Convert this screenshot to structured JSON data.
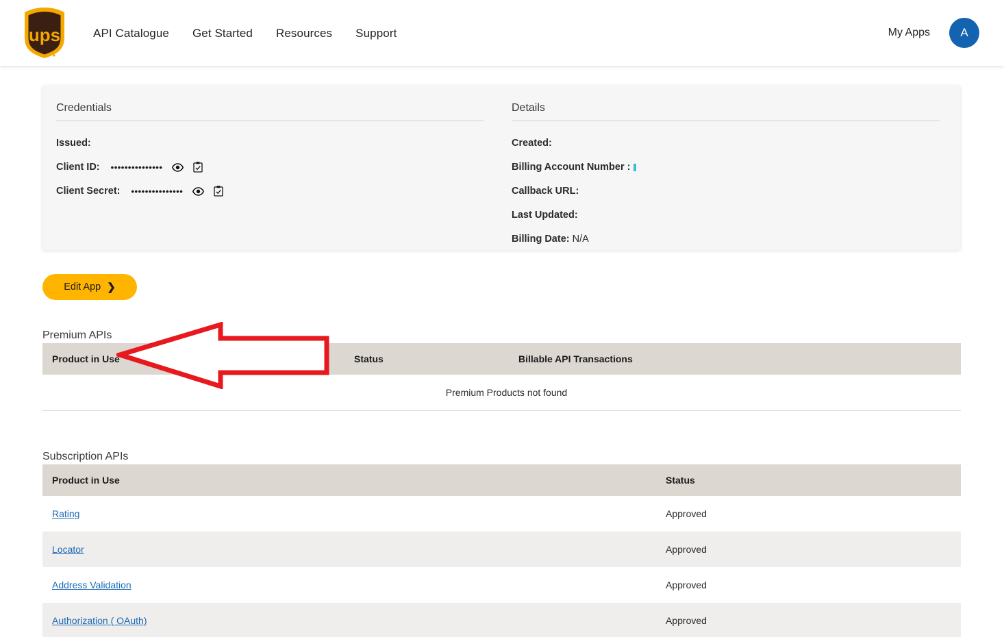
{
  "header": {
    "logo_alt": "UPS",
    "nav": [
      {
        "label": "API Catalogue"
      },
      {
        "label": "Get Started"
      },
      {
        "label": "Resources"
      },
      {
        "label": "Support"
      }
    ],
    "my_apps_label": "My Apps",
    "avatar_initial": "A"
  },
  "credentials": {
    "title": "Credentials",
    "issued_label": "Issued:",
    "issued_value": "",
    "client_id_label": "Client ID:",
    "client_id_value": "•••••••••••••••",
    "client_secret_label": "Client Secret:",
    "client_secret_value": "•••••••••••••••",
    "show_icon": "eye-icon",
    "copy_icon": "clipboard-check-icon"
  },
  "details": {
    "title": "Details",
    "created_label": "Created:",
    "created_value": "",
    "billing_account_label": "Billing Account Number :",
    "billing_account_value": "",
    "callback_url_label": "Callback URL:",
    "callback_url_value": "",
    "last_updated_label": "Last Updated:",
    "last_updated_value": "",
    "billing_date_label": "Billing Date:",
    "billing_date_value": "N/A"
  },
  "actions": {
    "edit_app_label": "Edit App",
    "edit_app_chevron": "›"
  },
  "annotation": {
    "type": "left-arrow",
    "color": "#e8191e",
    "points_to": "edit-app-button"
  },
  "premium_apis": {
    "heading": "Premium APIs",
    "columns": [
      "Product in Use",
      "Status",
      "Billable API Transactions"
    ],
    "empty_message": "Premium Products not found",
    "rows": []
  },
  "subscription_apis": {
    "heading": "Subscription APIs",
    "columns": [
      "Product in Use",
      "Status"
    ],
    "rows": [
      {
        "product": "Rating",
        "status": "Approved"
      },
      {
        "product": "Locator",
        "status": "Approved"
      },
      {
        "product": "Address Validation",
        "status": "Approved"
      },
      {
        "product": "Authorization ( OAuth)",
        "status": "Approved"
      }
    ]
  },
  "colors": {
    "ups_gold": "#f5a800",
    "ups_brown": "#3b1f13",
    "button_gold": "#ffb500",
    "link_blue": "#1a6bb5",
    "avatar_blue": "#1463b0",
    "table_header": "#dcd7d1",
    "row_alt": "#f0eeec",
    "annotation_red": "#e8191e",
    "card_bg": "#f6f6f6"
  }
}
